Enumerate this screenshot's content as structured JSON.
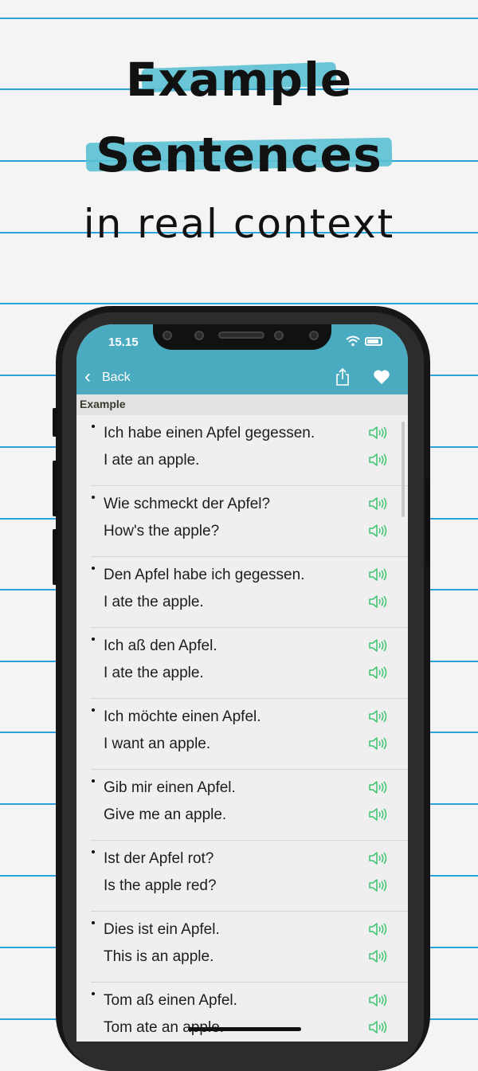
{
  "headline": {
    "line1": "Example",
    "line2": "Sentences",
    "line3": "in real context"
  },
  "status_bar": {
    "time": "15.15"
  },
  "nav": {
    "back_label": "Back",
    "back_icon": "chevron-left-icon",
    "share_icon": "share-icon",
    "favorite_icon": "heart-icon"
  },
  "section": {
    "title": "Example"
  },
  "sentences": [
    {
      "de": "Ich habe einen Apfel gegessen.",
      "en": "I ate an apple."
    },
    {
      "de": "Wie schmeckt der Apfel?",
      "en": "How's the apple?"
    },
    {
      "de": "Den Apfel habe ich gegessen.",
      "en": "I ate the apple."
    },
    {
      "de": "Ich aß den Apfel.",
      "en": "I ate the apple."
    },
    {
      "de": "Ich möchte einen Apfel.",
      "en": "I want an apple."
    },
    {
      "de": "Gib mir einen Apfel.",
      "en": "Give me an apple."
    },
    {
      "de": "Ist der Apfel rot?",
      "en": "Is the apple red?"
    },
    {
      "de": "Dies ist ein Apfel.",
      "en": "This is an apple."
    },
    {
      "de": "Tom aß einen Apfel.",
      "en": "Tom ate an apple."
    }
  ],
  "colors": {
    "nav_bar": "#4aaabf",
    "speaker_icon": "#3cc46e",
    "ruled_line": "#29a3dc",
    "highlight": "#5bc1d3"
  }
}
